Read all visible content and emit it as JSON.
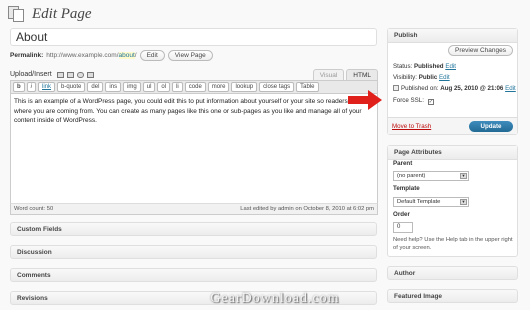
{
  "header": {
    "title": "Edit Page",
    "icon": "page-icon"
  },
  "title_field": {
    "value": "About"
  },
  "permalink": {
    "label": "Permalink:",
    "base": "http://www.example.com/",
    "slug": "about",
    "trail": "/",
    "edit_label": "Edit",
    "view_label": "View Page"
  },
  "upload": {
    "label": "Upload/Insert"
  },
  "editor_tabs": {
    "visual": "Visual",
    "html": "HTML"
  },
  "quicktags": [
    "b",
    "i",
    "link",
    "b-quote",
    "del",
    "ins",
    "img",
    "ul",
    "ol",
    "li",
    "code",
    "more",
    "lookup",
    "close tags",
    "Table"
  ],
  "editor": {
    "content": "This is an example of a WordPress page, you could edit this to put information about yourself or your site so readers know where you are coming from. You can create as many pages like this one or sub-pages as you like and manage all of your content inside of WordPress."
  },
  "status_bar": {
    "word_count": "Word count: 50",
    "last_edited": "Last edited by admin on October 8, 2010 at 6:02 pm"
  },
  "metaboxes": [
    "Custom Fields",
    "Discussion",
    "Comments",
    "Revisions"
  ],
  "publish": {
    "title": "Publish",
    "preview_label": "Preview Changes",
    "status_label": "Status:",
    "status_value": "Published",
    "visibility_label": "Visibility:",
    "visibility_value": "Public",
    "published_label": "Published on:",
    "published_value": "Aug 25, 2010 @ 21:06",
    "edit_label": "Edit",
    "ssl_label": "Force SSL:",
    "ssl_checked": true,
    "trash_label": "Move to Trash",
    "update_label": "Update"
  },
  "page_attributes": {
    "title": "Page Attributes",
    "parent_label": "Parent",
    "parent_value": "(no parent)",
    "template_label": "Template",
    "template_value": "Default Template",
    "order_label": "Order",
    "order_value": "0",
    "help_text": "Need help? Use the Help tab in the upper right of your screen."
  },
  "sidebar_boxes": {
    "author": "Author",
    "featured_image": "Featured Image"
  },
  "watermark": "GearDownload.com",
  "colors": {
    "accent": "#21759b",
    "update_button": "#2a7aab",
    "trash": "#bc0b0b",
    "annotation_arrow": "#e0201b"
  }
}
